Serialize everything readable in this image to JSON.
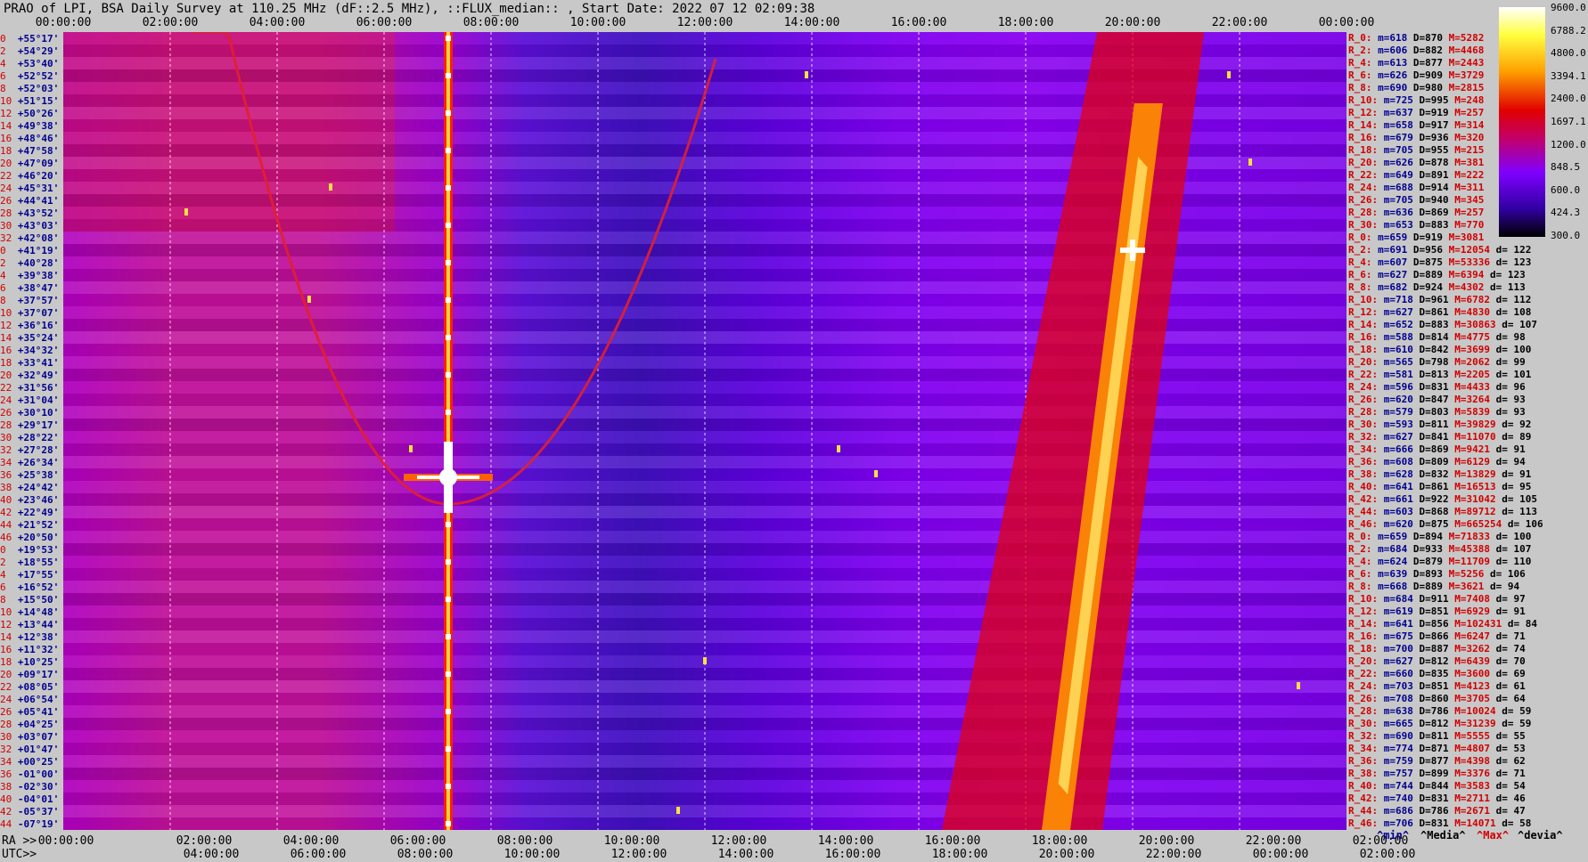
{
  "header": {
    "title": "PRAO of LPI, BSA Daily Survey at 110.25 MHz (dF::2.5 MHz), ::FLUX_median:: , Start Date: 2022 07 12 02:09:38"
  },
  "axes": {
    "top_ticks": [
      "00:00:00",
      "02:00:00",
      "04:00:00",
      "06:00:00",
      "08:00:00",
      "10:00:00",
      "12:00:00",
      "14:00:00",
      "16:00:00",
      "18:00:00",
      "20:00:00",
      "22:00:00",
      "00:00:00"
    ],
    "bottom_ticks_ra": [
      "00:00:00",
      "02:00:00",
      "04:00:00",
      "06:00:00",
      "08:00:00",
      "10:00:00",
      "12:00:00",
      "14:00:00",
      "16:00:00",
      "18:00:00",
      "20:00:00",
      "22:00:00",
      "02:00:00"
    ],
    "bottom_ticks_utc": [
      "04:00:00",
      "06:00:00",
      "08:00:00",
      "10:00:00",
      "12:00:00",
      "14:00:00",
      "16:00:00",
      "18:00:00",
      "20:00:00",
      "22:00:00",
      "00:00:00",
      "02:00:00"
    ],
    "ra_label": "RA >>",
    "utc_label": "UTC>>"
  },
  "declinations": [
    {
      "idx": "0",
      "dec": "+55°17'"
    },
    {
      "idx": "2",
      "dec": "+54°29'"
    },
    {
      "idx": "4",
      "dec": "+53°40'"
    },
    {
      "idx": "6",
      "dec": "+52°52'"
    },
    {
      "idx": "8",
      "dec": "+52°03'"
    },
    {
      "idx": "10",
      "dec": "+51°15'"
    },
    {
      "idx": "12",
      "dec": "+50°26'"
    },
    {
      "idx": "14",
      "dec": "+49°38'"
    },
    {
      "idx": "16",
      "dec": "+48°46'"
    },
    {
      "idx": "18",
      "dec": "+47°58'"
    },
    {
      "idx": "20",
      "dec": "+47°09'"
    },
    {
      "idx": "22",
      "dec": "+46°20'"
    },
    {
      "idx": "24",
      "dec": "+45°31'"
    },
    {
      "idx": "26",
      "dec": "+44°41'"
    },
    {
      "idx": "28",
      "dec": "+43°52'"
    },
    {
      "idx": "30",
      "dec": "+43°03'"
    },
    {
      "idx": "32",
      "dec": "+42°08'"
    },
    {
      "idx": "0",
      "dec": "+41°19'"
    },
    {
      "idx": "2",
      "dec": "+40°28'"
    },
    {
      "idx": "4",
      "dec": "+39°38'"
    },
    {
      "idx": "6",
      "dec": "+38°47'"
    },
    {
      "idx": "8",
      "dec": "+37°57'"
    },
    {
      "idx": "10",
      "dec": "+37°07'"
    },
    {
      "idx": "12",
      "dec": "+36°16'"
    },
    {
      "idx": "14",
      "dec": "+35°24'"
    },
    {
      "idx": "16",
      "dec": "+34°32'"
    },
    {
      "idx": "18",
      "dec": "+33°41'"
    },
    {
      "idx": "20",
      "dec": "+32°49'"
    },
    {
      "idx": "22",
      "dec": "+31°56'"
    },
    {
      "idx": "24",
      "dec": "+31°04'"
    },
    {
      "idx": "26",
      "dec": "+30°10'"
    },
    {
      "idx": "28",
      "dec": "+29°17'"
    },
    {
      "idx": "30",
      "dec": "+28°22'"
    },
    {
      "idx": "32",
      "dec": "+27°28'"
    },
    {
      "idx": "34",
      "dec": "+26°34'"
    },
    {
      "idx": "36",
      "dec": "+25°38'"
    },
    {
      "idx": "38",
      "dec": "+24°42'"
    },
    {
      "idx": "40",
      "dec": "+23°46'"
    },
    {
      "idx": "42",
      "dec": "+22°49'"
    },
    {
      "idx": "44",
      "dec": "+21°52'"
    },
    {
      "idx": "46",
      "dec": "+20°50'"
    },
    {
      "idx": "0",
      "dec": "+19°53'"
    },
    {
      "idx": "2",
      "dec": "+18°55'"
    },
    {
      "idx": "4",
      "dec": "+17°55'"
    },
    {
      "idx": "6",
      "dec": "+16°52'"
    },
    {
      "idx": "8",
      "dec": "+15°50'"
    },
    {
      "idx": "10",
      "dec": "+14°48'"
    },
    {
      "idx": "12",
      "dec": "+13°44'"
    },
    {
      "idx": "14",
      "dec": "+12°38'"
    },
    {
      "idx": "16",
      "dec": "+11°32'"
    },
    {
      "idx": "18",
      "dec": "+10°25'"
    },
    {
      "idx": "20",
      "dec": "+09°17'"
    },
    {
      "idx": "22",
      "dec": "+08°05'"
    },
    {
      "idx": "24",
      "dec": "+06°54'"
    },
    {
      "idx": "26",
      "dec": "+05°41'"
    },
    {
      "idx": "28",
      "dec": "+04°25'"
    },
    {
      "idx": "30",
      "dec": "+03°07'"
    },
    {
      "idx": "32",
      "dec": "+01°47'"
    },
    {
      "idx": "34",
      "dec": "+00°25'"
    },
    {
      "idx": "36",
      "dec": "-01°00'"
    },
    {
      "idx": "38",
      "dec": "-02°30'"
    },
    {
      "idx": "40",
      "dec": "-04°01'"
    },
    {
      "idx": "42",
      "dec": "-05°37'"
    },
    {
      "idx": "44",
      "dec": "-07°19'"
    }
  ],
  "stats": [
    {
      "r": "R_0:",
      "min": "m=618",
      "med": "D=870",
      "max": "M=5282",
      "dev": ""
    },
    {
      "r": "R_2:",
      "min": "m=606",
      "med": "D=882",
      "max": "M=4468",
      "dev": ""
    },
    {
      "r": "R_4:",
      "min": "m=613",
      "med": "D=877",
      "max": "M=2443",
      "dev": ""
    },
    {
      "r": "R_6:",
      "min": "m=626",
      "med": "D=909",
      "max": "M=3729",
      "dev": ""
    },
    {
      "r": "R_8:",
      "min": "m=690",
      "med": "D=980",
      "max": "M=2815",
      "dev": ""
    },
    {
      "r": "R_10:",
      "min": "m=725",
      "med": "D=995",
      "max": "M=248",
      "dev": ""
    },
    {
      "r": "R_12:",
      "min": "m=637",
      "med": "D=919",
      "max": "M=257",
      "dev": ""
    },
    {
      "r": "R_14:",
      "min": "m=658",
      "med": "D=917",
      "max": "M=314",
      "dev": ""
    },
    {
      "r": "R_16:",
      "min": "m=679",
      "med": "D=936",
      "max": "M=320",
      "dev": ""
    },
    {
      "r": "R_18:",
      "min": "m=705",
      "med": "D=955",
      "max": "M=215",
      "dev": ""
    },
    {
      "r": "R_20:",
      "min": "m=626",
      "med": "D=878",
      "max": "M=381",
      "dev": ""
    },
    {
      "r": "R_22:",
      "min": "m=649",
      "med": "D=891",
      "max": "M=222",
      "dev": ""
    },
    {
      "r": "R_24:",
      "min": "m=688",
      "med": "D=914",
      "max": "M=311",
      "dev": ""
    },
    {
      "r": "R_26:",
      "min": "m=705",
      "med": "D=940",
      "max": "M=345",
      "dev": ""
    },
    {
      "r": "R_28:",
      "min": "m=636",
      "med": "D=869",
      "max": "M=257",
      "dev": ""
    },
    {
      "r": "R_30:",
      "min": "m=653",
      "med": "D=883",
      "max": "M=770",
      "dev": ""
    },
    {
      "r": "R_0:",
      "min": "m=659",
      "med": "D=919",
      "max": "M=3081",
      "dev": ""
    },
    {
      "r": "R_2:",
      "min": "m=691",
      "med": "D=956",
      "max": "M=12054",
      "dev": "d= 122"
    },
    {
      "r": "R_4:",
      "min": "m=607",
      "med": "D=875",
      "max": "M=53336",
      "dev": "d= 123"
    },
    {
      "r": "R_6:",
      "min": "m=627",
      "med": "D=889",
      "max": "M=6394",
      "dev": "d= 123"
    },
    {
      "r": "R_8:",
      "min": "m=682",
      "med": "D=924",
      "max": "M=4302",
      "dev": "d= 113"
    },
    {
      "r": "R_10:",
      "min": "m=718",
      "med": "D=961",
      "max": "M=6782",
      "dev": "d= 112"
    },
    {
      "r": "R_12:",
      "min": "m=627",
      "med": "D=861",
      "max": "M=4830",
      "dev": "d= 108"
    },
    {
      "r": "R_14:",
      "min": "m=652",
      "med": "D=883",
      "max": "M=30863",
      "dev": "d= 107"
    },
    {
      "r": "R_16:",
      "min": "m=588",
      "med": "D=814",
      "max": "M=4775",
      "dev": "d= 98"
    },
    {
      "r": "R_18:",
      "min": "m=610",
      "med": "D=842",
      "max": "M=3699",
      "dev": "d= 100"
    },
    {
      "r": "R_20:",
      "min": "m=565",
      "med": "D=798",
      "max": "M=2062",
      "dev": "d= 99"
    },
    {
      "r": "R_22:",
      "min": "m=581",
      "med": "D=813",
      "max": "M=2205",
      "dev": "d= 101"
    },
    {
      "r": "R_24:",
      "min": "m=596",
      "med": "D=831",
      "max": "M=4433",
      "dev": "d= 96"
    },
    {
      "r": "R_26:",
      "min": "m=620",
      "med": "D=847",
      "max": "M=3264",
      "dev": "d= 93"
    },
    {
      "r": "R_28:",
      "min": "m=579",
      "med": "D=803",
      "max": "M=5839",
      "dev": "d= 93"
    },
    {
      "r": "R_30:",
      "min": "m=593",
      "med": "D=811",
      "max": "M=39829",
      "dev": "d= 92"
    },
    {
      "r": "R_32:",
      "min": "m=627",
      "med": "D=841",
      "max": "M=11070",
      "dev": "d= 89"
    },
    {
      "r": "R_34:",
      "min": "m=666",
      "med": "D=869",
      "max": "M=9421",
      "dev": "d= 91"
    },
    {
      "r": "R_36:",
      "min": "m=608",
      "med": "D=809",
      "max": "M=6129",
      "dev": "d= 94"
    },
    {
      "r": "R_38:",
      "min": "m=628",
      "med": "D=832",
      "max": "M=13829",
      "dev": "d= 91"
    },
    {
      "r": "R_40:",
      "min": "m=641",
      "med": "D=861",
      "max": "M=16513",
      "dev": "d= 95"
    },
    {
      "r": "R_42:",
      "min": "m=661",
      "med": "D=922",
      "max": "M=31042",
      "dev": "d= 105"
    },
    {
      "r": "R_44:",
      "min": "m=603",
      "med": "D=868",
      "max": "M=89712",
      "dev": "d= 113"
    },
    {
      "r": "R_46:",
      "min": "m=620",
      "med": "D=875",
      "max": "M=665254",
      "dev": "d= 106"
    },
    {
      "r": "R_0:",
      "min": "m=659",
      "med": "D=894",
      "max": "M=71833",
      "dev": "d= 100"
    },
    {
      "r": "R_2:",
      "min": "m=684",
      "med": "D=933",
      "max": "M=45388",
      "dev": "d= 107"
    },
    {
      "r": "R_4:",
      "min": "m=624",
      "med": "D=879",
      "max": "M=11709",
      "dev": "d= 110"
    },
    {
      "r": "R_6:",
      "min": "m=639",
      "med": "D=893",
      "max": "M=5256",
      "dev": "d= 106"
    },
    {
      "r": "R_8:",
      "min": "m=668",
      "med": "D=889",
      "max": "M=3621",
      "dev": "d= 94"
    },
    {
      "r": "R_10:",
      "min": "m=684",
      "med": "D=911",
      "max": "M=7408",
      "dev": "d= 97"
    },
    {
      "r": "R_12:",
      "min": "m=619",
      "med": "D=851",
      "max": "M=6929",
      "dev": "d= 91"
    },
    {
      "r": "R_14:",
      "min": "m=641",
      "med": "D=856",
      "max": "M=102431",
      "dev": "d= 84"
    },
    {
      "r": "R_16:",
      "min": "m=675",
      "med": "D=866",
      "max": "M=6247",
      "dev": "d= 71"
    },
    {
      "r": "R_18:",
      "min": "m=700",
      "med": "D=887",
      "max": "M=3262",
      "dev": "d= 74"
    },
    {
      "r": "R_20:",
      "min": "m=627",
      "med": "D=812",
      "max": "M=6439",
      "dev": "d= 70"
    },
    {
      "r": "R_22:",
      "min": "m=660",
      "med": "D=835",
      "max": "M=3600",
      "dev": "d= 69"
    },
    {
      "r": "R_24:",
      "min": "m=703",
      "med": "D=851",
      "max": "M=4123",
      "dev": "d= 61"
    },
    {
      "r": "R_26:",
      "min": "m=708",
      "med": "D=860",
      "max": "M=3705",
      "dev": "d= 64"
    },
    {
      "r": "R_28:",
      "min": "m=638",
      "med": "D=786",
      "max": "M=10024",
      "dev": "d= 59"
    },
    {
      "r": "R_30:",
      "min": "m=665",
      "med": "D=812",
      "max": "M=31239",
      "dev": "d= 59"
    },
    {
      "r": "R_32:",
      "min": "m=690",
      "med": "D=811",
      "max": "M=5555",
      "dev": "d= 55"
    },
    {
      "r": "R_34:",
      "min": "m=774",
      "med": "D=871",
      "max": "M=4807",
      "dev": "d= 53"
    },
    {
      "r": "R_36:",
      "min": "m=759",
      "med": "D=877",
      "max": "M=4398",
      "dev": "d= 62"
    },
    {
      "r": "R_38:",
      "min": "m=757",
      "med": "D=899",
      "max": "M=3376",
      "dev": "d= 71"
    },
    {
      "r": "R_40:",
      "min": "m=744",
      "med": "D=844",
      "max": "M=3583",
      "dev": "d= 54"
    },
    {
      "r": "R_42:",
      "min": "m=740",
      "med": "D=831",
      "max": "M=2711",
      "dev": "d= 46"
    },
    {
      "r": "R_44:",
      "min": "m=686",
      "med": "D=786",
      "max": "M=2671",
      "dev": "d= 47"
    },
    {
      "r": "R_46:",
      "min": "m=706",
      "med": "D=831",
      "max": "M=14071",
      "dev": "d= 58"
    }
  ],
  "legend": {
    "min": "^min^",
    "median": "^Media^",
    "max": "^Max^",
    "dev": "^devia^"
  },
  "colorbar": {
    "labels": [
      "9600.0",
      "6788.2",
      "4800.0",
      "3394.1",
      "2400.0",
      "1697.1",
      "1200.0",
      "848.5",
      "600.0",
      "424.3",
      "300.0"
    ]
  },
  "colors": {
    "background": "#c8c8c8",
    "low": "#000000",
    "mid": "#7a00ff",
    "warm": "#e00000",
    "hot": "#ffff40",
    "max": "#ffffff"
  },
  "chart_data": {
    "type": "heatmap",
    "title": "PRAO of LPI, BSA Daily Survey at 110.25 MHz (dF::2.5 MHz), ::FLUX_median:: , Start Date: 2022 07 12 02:09:38",
    "x_axis": "RA / UTC",
    "x_range_hours": [
      0,
      24
    ],
    "rows": 64,
    "color_scale": "log",
    "color_range": [
      300.0,
      9600.0
    ],
    "features": [
      {
        "name": "vertical strong source",
        "ra_hours": 7.2,
        "intensity": 9600
      },
      {
        "name": "bright point",
        "ra_hours": 7.2,
        "dec": "+21°52'",
        "intensity": 9600
      },
      {
        "name": "galactic plane ridge",
        "ra_hours": [
          18.6,
          20.4
        ],
        "dec_range": [
          "-07°19'",
          "+47°58'"
        ],
        "intensity": 4800
      },
      {
        "name": "bright point",
        "ra_hours": 20.0,
        "dec": "+41°19'",
        "intensity": 9600
      },
      {
        "name": "source trail arc left",
        "ra_hours": [
          2.4,
          7.2
        ],
        "intensity": 1697
      },
      {
        "name": "source trail arc right",
        "ra_hours": [
          7.2,
          12.2
        ],
        "intensity": 1200
      }
    ],
    "grid": true,
    "grid_lines_hours": [
      2,
      4,
      6,
      8,
      10,
      12,
      14,
      16,
      18,
      20,
      22
    ]
  }
}
